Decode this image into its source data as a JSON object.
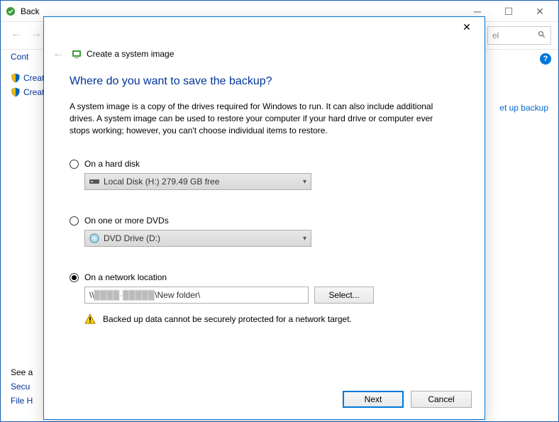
{
  "back_window": {
    "title": "Back",
    "nav_left_disabled": true,
    "nav_right_disabled": true,
    "search_placeholder": "el",
    "heading": "Cont",
    "links": [
      "Creat",
      "Creat"
    ],
    "right_link": "et up backup",
    "bottom_heading": "See a",
    "bottom_links": [
      "Secu",
      "File H"
    ]
  },
  "dialog": {
    "title": "Create a system image",
    "question": "Where do you want to save the backup?",
    "description": "A system image is a copy of the drives required for Windows to run. It can also include additional drives. A system image can be used to restore your computer if your hard drive or computer ever stops working; however, you can't choose individual items to restore.",
    "options": {
      "hard_disk": {
        "label": "On a hard disk",
        "value": "Local Disk (H:)  279.49 GB free",
        "selected": false
      },
      "dvd": {
        "label": "On one or more DVDs",
        "value": "DVD Drive (D:)",
        "selected": false
      },
      "network": {
        "label": "On a network location",
        "path_prefix": "\\\\",
        "path_suffix": "\\New folder\\",
        "select_button": "Select...",
        "warning": "Backed up data cannot be securely protected for a network target.",
        "selected": true
      }
    },
    "buttons": {
      "next": "Next",
      "cancel": "Cancel"
    }
  }
}
